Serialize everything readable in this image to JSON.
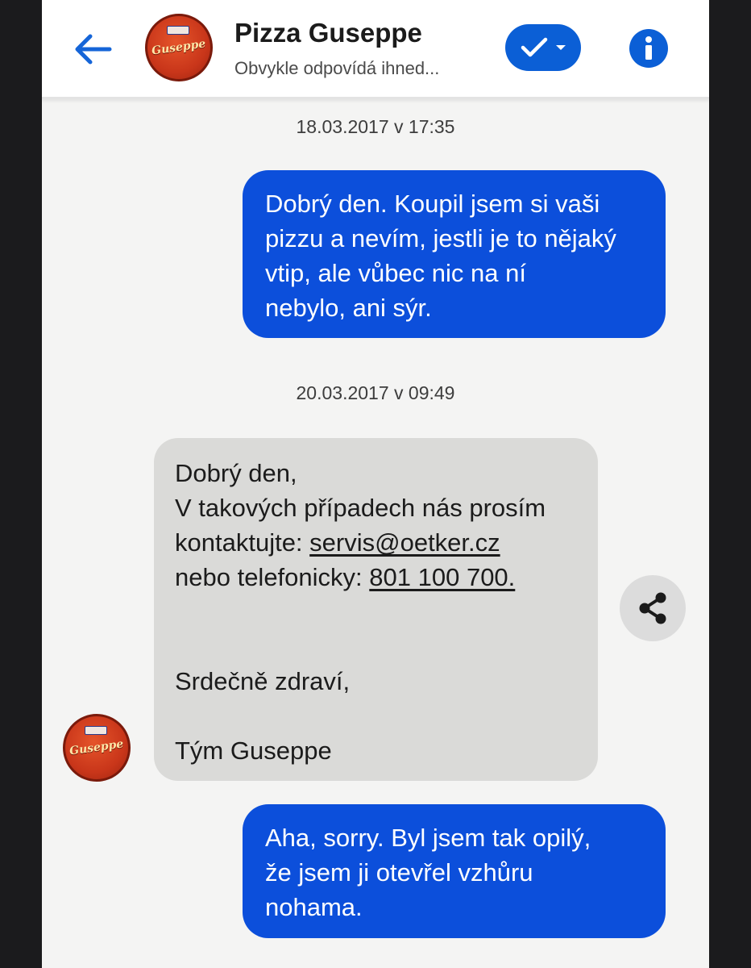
{
  "header": {
    "title": "Pizza Guseppe",
    "subtitle": "Obvykle odpovídá ihned...",
    "logo_text": "Guseppe",
    "back_icon": "arrow-left-icon",
    "verified_icon": "check-icon",
    "dropdown_icon": "chevron-down-icon",
    "info_icon": "info-icon",
    "accent_color": "#0b5fd6"
  },
  "messages": [
    {
      "timestamp": "18.03.2017 v 17:35",
      "direction": "outgoing",
      "lines": [
        "Dobrý den. Koupil jsem si vaši",
        "pizzu a nevím, jestli je to nějaký",
        "vtip, ale vůbec nic na ní",
        "nebylo, ani sýr."
      ]
    },
    {
      "timestamp": "20.03.2017 v 09:49",
      "direction": "incoming",
      "greeting": "Dobrý den,",
      "line2": "V takových případech nás prosím",
      "contact_prefix": "kontaktujte:",
      "email": "servis@oetker.cz",
      "phone_prefix": "nebo telefonicky:",
      "phone": "801 100 700.",
      "closing": "Srdečně zdraví,",
      "signature": "Tým Guseppe",
      "share_icon": "share-icon"
    },
    {
      "direction": "outgoing",
      "lines": [
        "Aha, sorry. Byl jsem tak opilý,",
        "že jsem ji otevřel vzhůru",
        "nohama."
      ]
    }
  ],
  "colors": {
    "outgoing_bubble": "#0c4fdb",
    "incoming_bubble": "#dadad8",
    "background": "#f4f4f3"
  }
}
